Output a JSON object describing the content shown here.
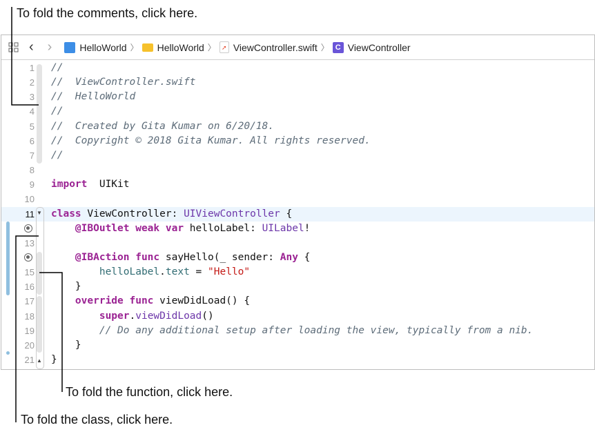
{
  "callouts": {
    "comments": "To fold the comments, click here.",
    "function": "To fold the function, click here.",
    "class": "To fold the class, click here."
  },
  "toolbar": {
    "grid_icon": "related-items-grid-icon",
    "back_icon": "chevron-left-icon",
    "forward_icon": "chevron-right-icon",
    "breadcrumbs": [
      {
        "label": "HelloWorld",
        "icon": "xcode-project-icon"
      },
      {
        "label": "HelloWorld",
        "icon": "folder-icon"
      },
      {
        "label": "ViewController.swift",
        "icon": "swift-file-icon"
      },
      {
        "label": "ViewController",
        "icon": "class-c-icon"
      }
    ]
  },
  "colors": {
    "keyword": "#9b2393",
    "comment": "#5d6c79",
    "type": "#6c36a9",
    "string": "#c41a16",
    "current_line": "#ecf5fd",
    "change_bar": "#8fbfdf"
  },
  "code": {
    "current_line": 11,
    "lines": [
      {
        "n": "1",
        "t": [
          [
            "cm",
            "//"
          ]
        ]
      },
      {
        "n": "2",
        "t": [
          [
            "cm",
            "//  ViewController.swift"
          ]
        ]
      },
      {
        "n": "3",
        "t": [
          [
            "cm",
            "//  HelloWorld"
          ]
        ]
      },
      {
        "n": "4",
        "t": [
          [
            "cm",
            "//"
          ]
        ]
      },
      {
        "n": "5",
        "t": [
          [
            "cm",
            "//  Created by Gita Kumar on 6/20/18."
          ]
        ]
      },
      {
        "n": "6",
        "t": [
          [
            "cm",
            "//  Copyright © 2018 Gita Kumar. All rights reserved."
          ]
        ]
      },
      {
        "n": "7",
        "t": [
          [
            "cm",
            "//"
          ]
        ]
      },
      {
        "n": "8",
        "t": []
      },
      {
        "n": "9",
        "t": [
          [
            "kw",
            "import"
          ],
          [
            "",
            "  UIKit"
          ]
        ]
      },
      {
        "n": "10",
        "t": []
      },
      {
        "n": "11",
        "t": [
          [
            "kw",
            "class"
          ],
          [
            "",
            " ViewController: "
          ],
          [
            "ty",
            "UIViewController"
          ],
          [
            "",
            " {"
          ]
        ]
      },
      {
        "n": "12",
        "bp": true,
        "t": [
          [
            "",
            "    "
          ],
          [
            "kw",
            "@IBOutlet weak var"
          ],
          [
            "",
            " helloLabel: "
          ],
          [
            "ty",
            "UILabel"
          ],
          [
            "",
            "!"
          ]
        ]
      },
      {
        "n": "13",
        "t": []
      },
      {
        "n": "14",
        "bp": true,
        "t": [
          [
            "",
            "    "
          ],
          [
            "kw",
            "@IBAction func"
          ],
          [
            "",
            " sayHello(_ sender: "
          ],
          [
            "kw",
            "Any"
          ],
          [
            "",
            " {"
          ]
        ]
      },
      {
        "n": "15",
        "t": [
          [
            "",
            "        "
          ],
          [
            "mb",
            "helloLabel"
          ],
          [
            "",
            "."
          ],
          [
            "mb",
            "text"
          ],
          [
            "",
            " = "
          ],
          [
            "st",
            "\"Hello\""
          ]
        ]
      },
      {
        "n": "16",
        "t": [
          [
            "",
            "    }"
          ]
        ]
      },
      {
        "n": "17",
        "t": [
          [
            "",
            "    "
          ],
          [
            "kw",
            "override func"
          ],
          [
            "",
            " viewDidLoad() {"
          ]
        ]
      },
      {
        "n": "18",
        "t": [
          [
            "",
            "        "
          ],
          [
            "kw",
            "super"
          ],
          [
            "",
            "."
          ],
          [
            "ty",
            "viewDidLoad"
          ],
          [
            "",
            "()"
          ]
        ]
      },
      {
        "n": "19",
        "t": [
          [
            "",
            "        "
          ],
          [
            "cm",
            "// Do any additional setup after loading the view, typically from a nib."
          ]
        ]
      },
      {
        "n": "20",
        "t": [
          [
            "",
            "    }"
          ]
        ]
      },
      {
        "n": "21",
        "t": [
          [
            "",
            "}"
          ]
        ]
      }
    ]
  }
}
